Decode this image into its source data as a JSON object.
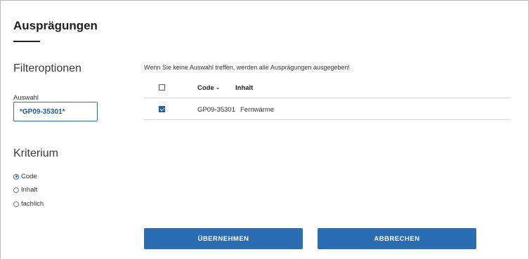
{
  "page": {
    "title": "Ausprägungen"
  },
  "filter": {
    "heading": "Filteroptionen",
    "auswahl_label": "Auswahl",
    "auswahl_value": "*GP09-35301*"
  },
  "criteria": {
    "heading": "Kriterium",
    "options": [
      {
        "label": "Code",
        "selected": true
      },
      {
        "label": "Inhalt",
        "selected": false
      },
      {
        "label": "fachlich",
        "selected": false
      }
    ]
  },
  "results": {
    "hint": "Wenn Sie keine Auswahl treffen, werden alle Ausprägungen ausgegeben!",
    "columns": {
      "code": "Code",
      "inhalt": "Inhalt"
    },
    "rows": [
      {
        "checked": true,
        "code": "GP09-35301",
        "inhalt": "Fernwärme"
      }
    ]
  },
  "actions": {
    "apply_label": "ÜBERNEHMEN",
    "cancel_label": "ABBRECHEN"
  },
  "colors": {
    "accent": "#2a6db3"
  }
}
